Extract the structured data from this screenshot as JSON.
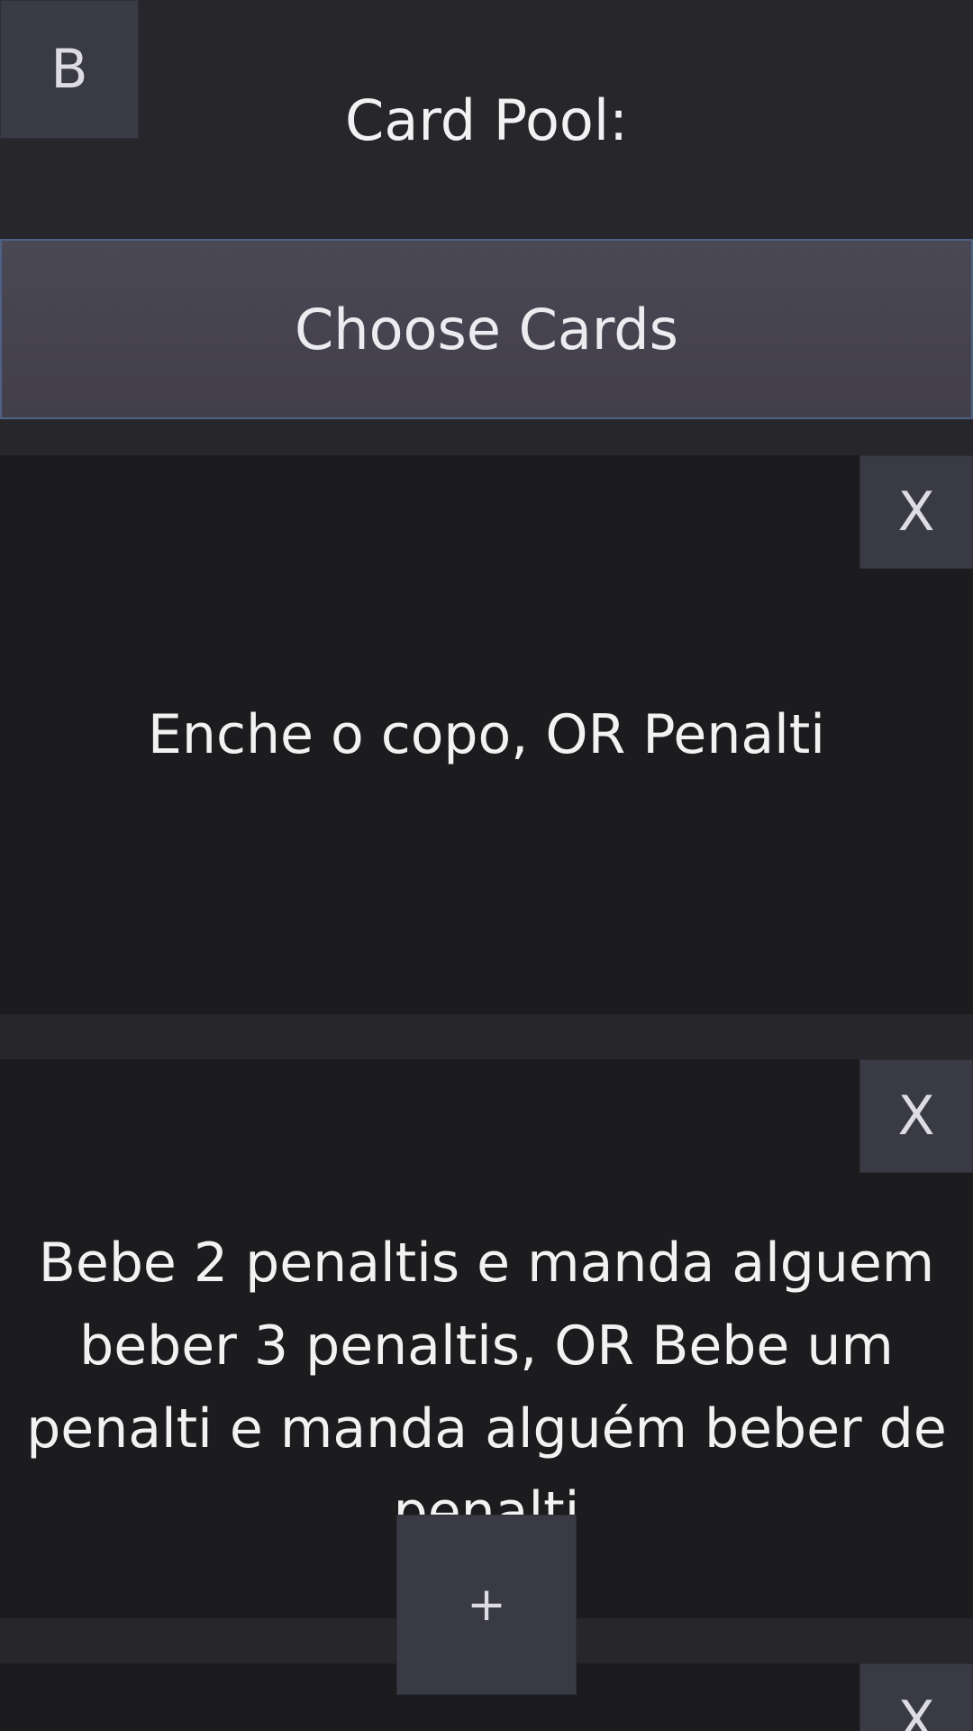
{
  "header": {
    "back_label": "B",
    "title": "Card Pool:"
  },
  "actions": {
    "choose_cards_label": "Choose Cards",
    "add_label": "+"
  },
  "cards": [
    {
      "text": "Enche o copo, OR Penalti",
      "remove_label": "X"
    },
    {
      "text": "Bebe 2 penaltis e manda alguem beber 3 penaltis, OR Bebe um penalti e manda alguém beber de penalti",
      "remove_label": "X"
    },
    {
      "text": "",
      "remove_label": "X"
    }
  ]
}
